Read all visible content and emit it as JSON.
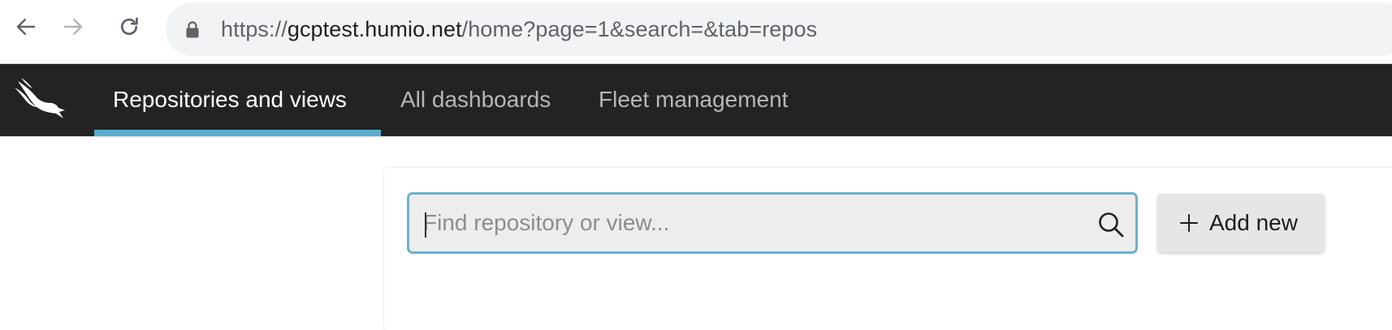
{
  "browser": {
    "url_scheme": "https://",
    "url_host": "gcptest.humio.net",
    "url_path": "/home?page=1&search=&tab=repos",
    "icons": [
      "back-arrow-icon",
      "forward-arrow-icon",
      "reload-icon",
      "lock-icon"
    ]
  },
  "header": {
    "logo_icon": "falcon-logo-icon",
    "tabs": [
      {
        "label": "Repositories and views",
        "active": true
      },
      {
        "label": "All dashboards",
        "active": false
      },
      {
        "label": "Fleet management",
        "active": false
      }
    ],
    "accent_color": "#5aaccc",
    "background_color": "#232323"
  },
  "main": {
    "search": {
      "value": "",
      "placeholder": "Find repository or view...",
      "icon": "search-icon"
    },
    "add_button": {
      "label": "Add new",
      "icon": "plus-icon"
    }
  }
}
